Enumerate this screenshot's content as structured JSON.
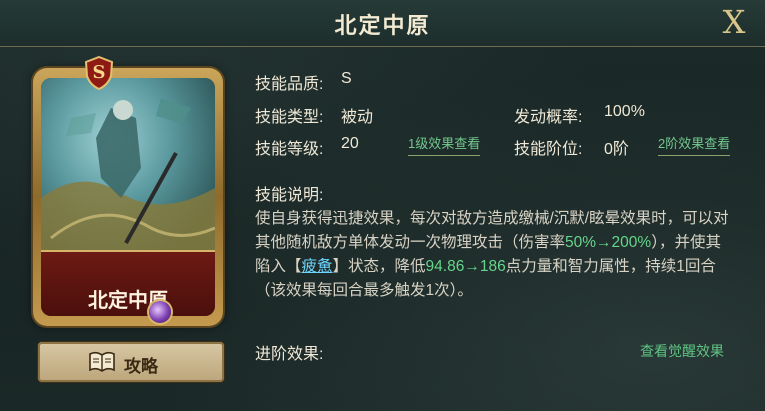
{
  "title": "北定中原",
  "close_label": "X",
  "card": {
    "name": "北定中原",
    "rank": "S"
  },
  "guide_button": {
    "label": "攻略",
    "icon": "book-icon"
  },
  "stats": {
    "quality_label": "技能品质:",
    "quality_value": "S",
    "type_label": "技能类型:",
    "type_value": "被动",
    "trigger_label": "发动概率:",
    "trigger_value": "100%",
    "level_label": "技能等级:",
    "level_value": "20",
    "level_link": "1级效果查看",
    "tier_label": "技能阶位:",
    "tier_value": "0阶",
    "tier_link": "2阶效果查看"
  },
  "description": {
    "label": "技能说明:",
    "part1": "使自身获得迅捷效果，每次对敌方造成缴械/沉默/眩晕效果时，可以对其他随机敌方单体发动一次物理攻击（伤害率",
    "dmg_rate": "50%→200%",
    "part2": "），并使其陷入【",
    "keyword": "疲惫",
    "part3": "】状态，降低",
    "reduce": "94.86→186",
    "part4": "点力量和智力属性，持续1回合（该效果每回合最多触发1次）。"
  },
  "advanced": {
    "label": "进阶效果:",
    "link": "查看觉醒效果"
  },
  "colors": {
    "accent_green": "#65d68a",
    "keyword_blue": "#6fd6ff",
    "gold": "#d9c58a"
  }
}
